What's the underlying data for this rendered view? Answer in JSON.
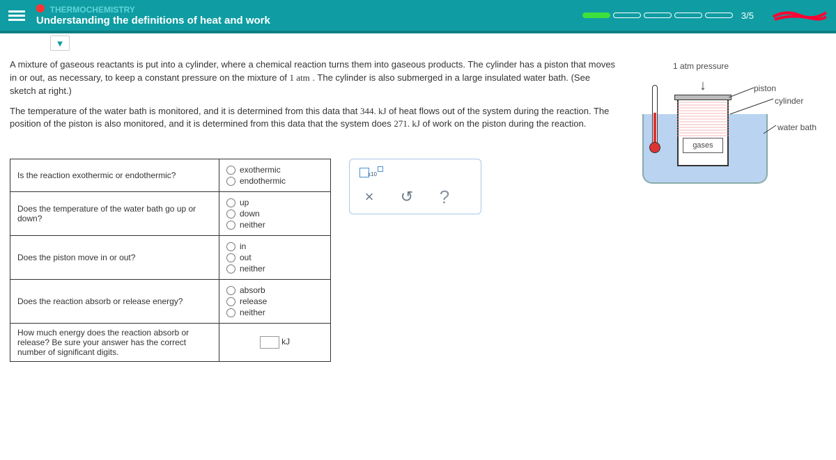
{
  "header": {
    "subject": "THERMOCHEMISTRY",
    "lesson": "Understanding the definitions of heat and work",
    "progress": "3/5"
  },
  "problem": {
    "p1_pre": "A mixture of gaseous reactants is put into a cylinder, where a chemical reaction turns them into gaseous products. The cylinder has a piston that moves in or out, as necessary, to keep a constant pressure on the mixture of ",
    "pressure": "1 atm",
    "p1_post": ". The cylinder is also submerged in a large insulated water bath. (See sketch at right.)",
    "p2_pre": "The temperature of the water bath is monitored, and it is determined from this data that ",
    "heat": "344. kJ",
    "p2_mid": " of heat flows out of the system during the reaction. The position of the piston is also monitored, and it is determined from this data that the system does ",
    "work": "271. kJ",
    "p2_post": " of work on the piston during the reaction."
  },
  "diagram": {
    "pressure_label": "1 atm pressure",
    "piston": "piston",
    "cylinder": "cylinder",
    "water_bath": "water bath",
    "gases": "gases"
  },
  "questions": {
    "q1": "Is the reaction exothermic or endothermic?",
    "q1_a": "exothermic",
    "q1_b": "endothermic",
    "q2": "Does the temperature of the water bath go up or down?",
    "q2_a": "up",
    "q2_b": "down",
    "q2_c": "neither",
    "q3": "Does the piston move in or out?",
    "q3_a": "in",
    "q3_b": "out",
    "q3_c": "neither",
    "q4": "Does the reaction absorb or release energy?",
    "q4_a": "absorb",
    "q4_b": "release",
    "q4_c": "neither",
    "q5": "How much energy does the reaction absorb or release? Be sure your answer has the correct number of significant digits.",
    "q5_unit": "kJ"
  },
  "toolpanel": {
    "x10": "x10",
    "times": "×",
    "undo": "↺",
    "help": "?"
  }
}
